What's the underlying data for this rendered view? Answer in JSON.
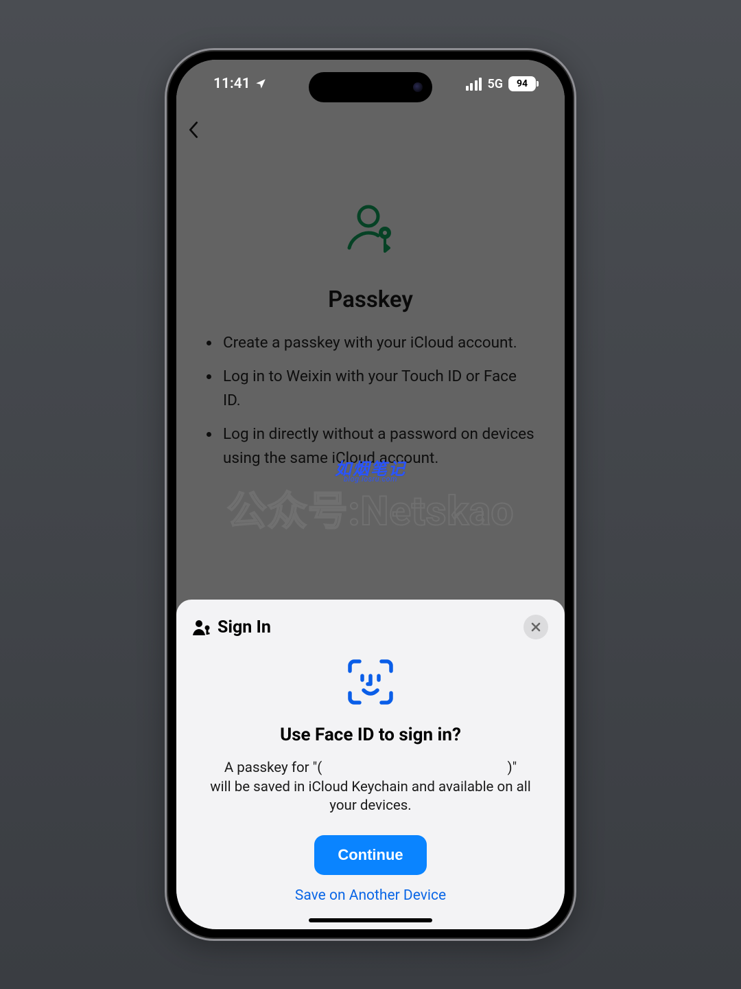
{
  "statusbar": {
    "time": "11:41",
    "network": "5G",
    "battery": "94"
  },
  "app": {
    "title": "Passkey",
    "bullets": [
      "Create a passkey with your iCloud account.",
      "Log in to Weixin with your Touch ID or Face ID.",
      "Log in directly without a password on devices using the same iCloud account."
    ]
  },
  "watermark": {
    "cn": "如烟笔记",
    "sub": "blog.losru.com",
    "main": "公众号:Netskao"
  },
  "sheet": {
    "header": "Sign In",
    "heading": "Use Face ID to sign in?",
    "body_line1": "A passkey for \"(",
    "body_line1_end": ")\"",
    "body_line2": "will be saved in iCloud Keychain and available on all your devices.",
    "continue": "Continue",
    "alt": "Save on Another Device"
  }
}
